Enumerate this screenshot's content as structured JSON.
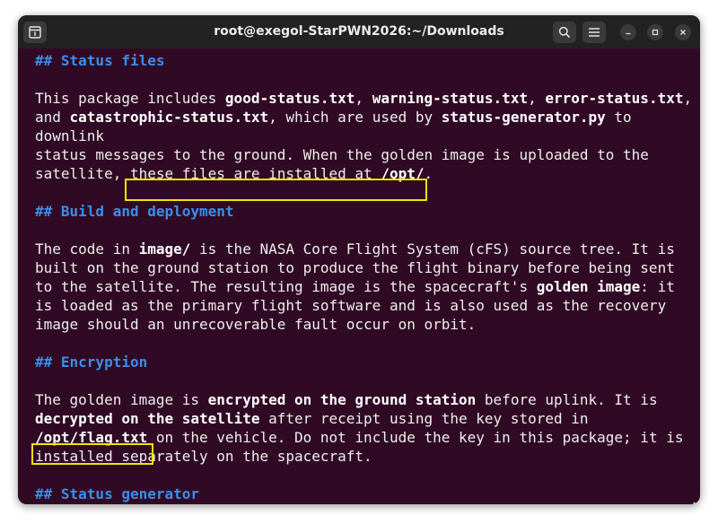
{
  "window": {
    "title": "root@exegol-StarPWN2026:~/Downloads"
  },
  "terminal": {
    "lines": [
      {
        "segments": [
          {
            "t": "## Status files",
            "k": "heading"
          }
        ]
      },
      {
        "segments": []
      },
      {
        "segments": [
          {
            "t": "This package includes "
          },
          {
            "t": "good-status.txt",
            "k": "b"
          },
          {
            "t": ", "
          },
          {
            "t": "warning-status.txt",
            "k": "b"
          },
          {
            "t": ", "
          },
          {
            "t": "error-status.txt",
            "k": "b"
          },
          {
            "t": ","
          }
        ]
      },
      {
        "segments": [
          {
            "t": "and "
          },
          {
            "t": "catastrophic-status.txt",
            "k": "b"
          },
          {
            "t": ", which are used by "
          },
          {
            "t": "status-generator.py",
            "k": "b"
          },
          {
            "t": " to"
          }
        ]
      },
      {
        "segments": [
          {
            "t": "downlink"
          }
        ]
      },
      {
        "segments": [
          {
            "t": "status messages to the ground. When the golden image is uploaded to the"
          }
        ]
      },
      {
        "segments": [
          {
            "t": "satellite, these files are installed at "
          },
          {
            "t": "/opt/",
            "k": "b"
          },
          {
            "t": "."
          }
        ]
      },
      {
        "segments": []
      },
      {
        "segments": [
          {
            "t": "## Build and deployment",
            "k": "heading"
          }
        ]
      },
      {
        "segments": []
      },
      {
        "segments": [
          {
            "t": "The code in "
          },
          {
            "t": "image/",
            "k": "b"
          },
          {
            "t": " is the NASA Core Flight System (cFS) source tree. It is"
          }
        ]
      },
      {
        "segments": [
          {
            "t": "built on the ground station to produce the flight binary before being sent"
          }
        ]
      },
      {
        "segments": [
          {
            "t": "to the satellite. The resulting image is the spacecraft's "
          },
          {
            "t": "golden image",
            "k": "b"
          },
          {
            "t": ": it"
          }
        ]
      },
      {
        "segments": [
          {
            "t": "is loaded as the primary flight software and is also used as the recovery"
          }
        ]
      },
      {
        "segments": [
          {
            "t": "image should an unrecoverable fault occur on orbit."
          }
        ]
      },
      {
        "segments": []
      },
      {
        "segments": [
          {
            "t": "## Encryption",
            "k": "heading"
          }
        ]
      },
      {
        "segments": []
      },
      {
        "segments": [
          {
            "t": "The golden image is "
          },
          {
            "t": "encrypted on the ground station",
            "k": "b"
          },
          {
            "t": " before uplink. It is"
          }
        ]
      },
      {
        "segments": [
          {
            "t": "decrypted on the satellite",
            "k": "b"
          },
          {
            "t": " after receipt using the key stored in"
          }
        ]
      },
      {
        "segments": [
          {
            "t": "/opt/flag.txt",
            "k": "b"
          },
          {
            "t": " on the vehicle. Do not include the key in this package; it is"
          }
        ]
      },
      {
        "segments": [
          {
            "t": "installed separately on the spacecraft."
          }
        ]
      },
      {
        "segments": []
      },
      {
        "segments": [
          {
            "t": "## Status generator",
            "k": "heading"
          }
        ]
      }
    ]
  },
  "icons": {
    "new_tab": "new-tab-icon",
    "search": "search-icon",
    "menu": "hamburger-menu-icon",
    "minimize": "minimize-icon",
    "maximize": "maximize-icon",
    "close": "close-icon"
  },
  "colors": {
    "terminal_background": "#300a24",
    "titlebar": "#222222",
    "heading": "#3b8eea",
    "text": "#eeeeec",
    "highlight_box": "#f2e400"
  }
}
